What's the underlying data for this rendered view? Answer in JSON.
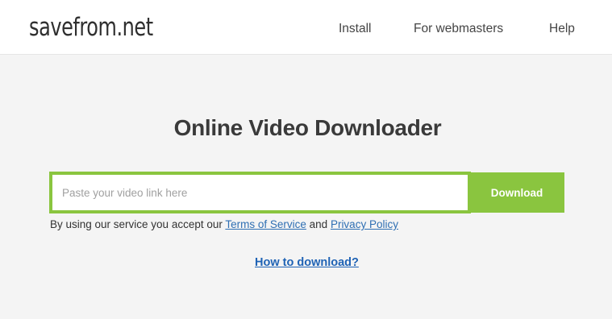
{
  "header": {
    "logo_text": "savefrom.net",
    "nav": {
      "install": "Install",
      "webmasters": "For webmasters",
      "help": "Help"
    }
  },
  "main": {
    "title": "Online Video Downloader",
    "search": {
      "placeholder": "Paste your video link here",
      "value": ""
    },
    "download_label": "Download",
    "terms": {
      "prefix": "By using our service you accept our ",
      "terms_link": "Terms of Service",
      "conjunction": " and ",
      "privacy_link": "Privacy Policy"
    },
    "how_to_link": "How to download?"
  },
  "colors": {
    "accent_green": "#8ac53f",
    "link_blue": "#1f63b5",
    "background": "#f4f4f4",
    "header_background": "#ffffff"
  }
}
